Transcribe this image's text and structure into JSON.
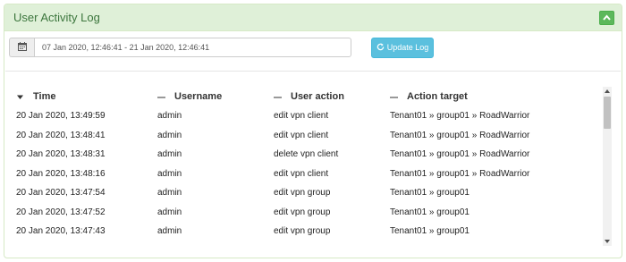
{
  "panel": {
    "title": "User Activity Log"
  },
  "toolbar": {
    "date_range": "07 Jan 2020, 12:46:41 - 21 Jan 2020, 12:46:41",
    "update_label": "Update Log"
  },
  "table": {
    "columns": [
      "Time",
      "Username",
      "User action",
      "Action target"
    ],
    "sort": {
      "column": "Time",
      "direction": "descending"
    },
    "rows": [
      {
        "time": "20 Jan 2020, 13:49:59",
        "user": "admin",
        "action": "edit vpn client",
        "target": "Tenant01 » group01 » RoadWarrior"
      },
      {
        "time": "20 Jan 2020, 13:48:41",
        "user": "admin",
        "action": "edit vpn client",
        "target": "Tenant01 » group01 » RoadWarrior"
      },
      {
        "time": "20 Jan 2020, 13:48:31",
        "user": "admin",
        "action": "delete vpn client",
        "target": "Tenant01 » group01 » RoadWarrior"
      },
      {
        "time": "20 Jan 2020, 13:48:16",
        "user": "admin",
        "action": "edit vpn client",
        "target": "Tenant01 » group01 » RoadWarrior"
      },
      {
        "time": "20 Jan 2020, 13:47:54",
        "user": "admin",
        "action": "edit vpn group",
        "target": "Tenant01 » group01"
      },
      {
        "time": "20 Jan 2020, 13:47:52",
        "user": "admin",
        "action": "edit vpn group",
        "target": "Tenant01 » group01"
      },
      {
        "time": "20 Jan 2020, 13:47:43",
        "user": "admin",
        "action": "edit vpn group",
        "target": "Tenant01 » group01"
      }
    ]
  },
  "icons": {
    "collapse": "chevron-up-icon",
    "date": "calendar-icon",
    "update": "refresh-icon"
  },
  "colors": {
    "heading_bg": "#dff0d8",
    "heading_text": "#3c763d",
    "collapse_button": "#5cb85c",
    "update_button": "#5bc0de"
  }
}
